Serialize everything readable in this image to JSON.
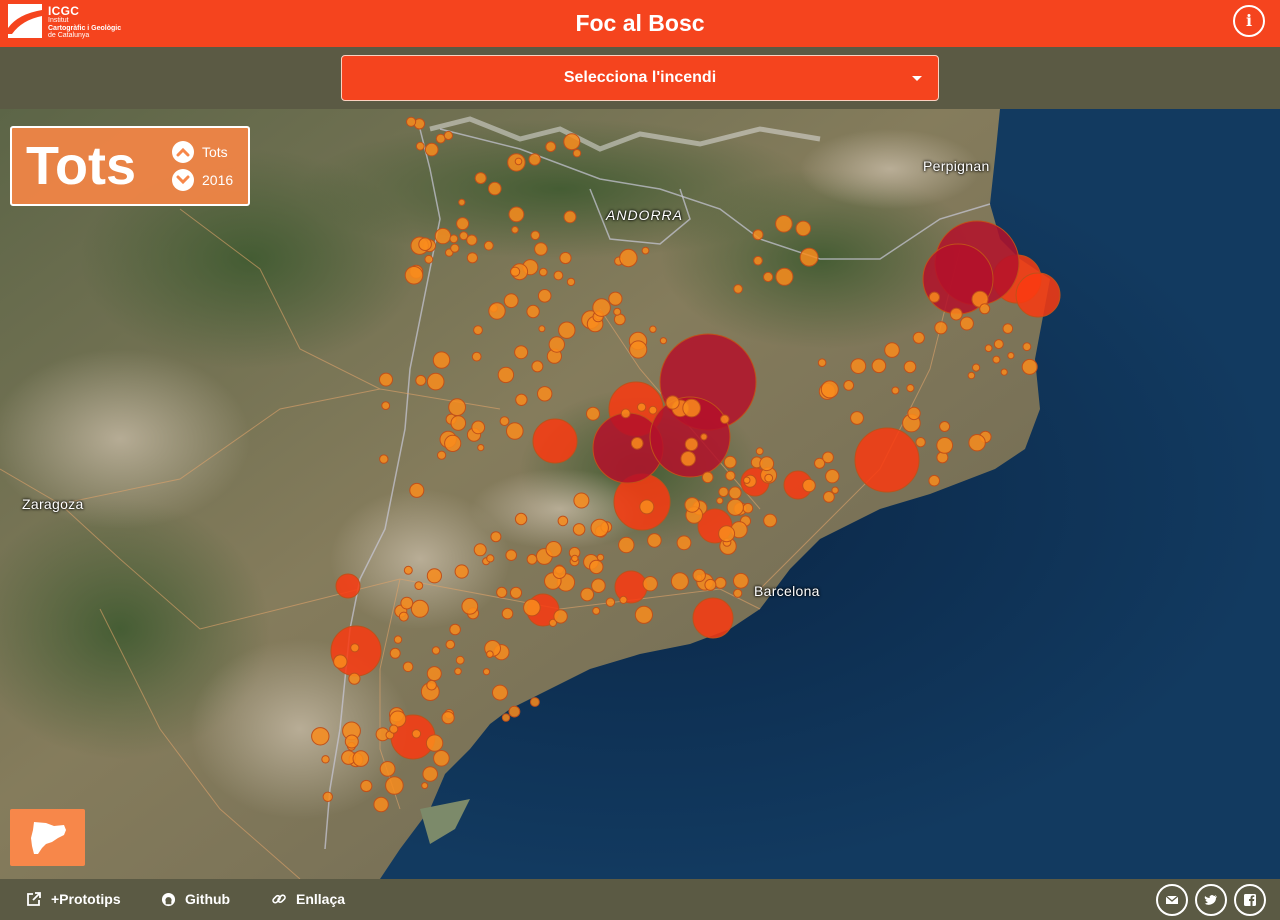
{
  "header": {
    "logo": {
      "abbr": "ICGC",
      "line1": "Institut",
      "line2": "Cartogràfic i Geològic",
      "line3": "de Catalunya"
    },
    "title": "Foc al Bosc",
    "info_icon": "info-icon",
    "info_glyph": "i"
  },
  "selector": {
    "label": "Selecciona l'incendi",
    "caret_icon": "caret-down-icon"
  },
  "filter": {
    "current": "Tots",
    "up_icon": "chevron-up-icon",
    "up_label": "Tots",
    "down_icon": "chevron-down-icon",
    "down_label": "2016"
  },
  "map": {
    "labels": {
      "andorra": "ANDORRA",
      "perpignan": "Perpignan",
      "zaragoza": "Zaragoza",
      "barcelona": "Barcelona"
    },
    "colors": {
      "small_fire": "#f98c1c",
      "medium_fire": "#fa3a10",
      "large_fire": "#b4102a",
      "sea": "#0e2d4e"
    }
  },
  "catalonia_button": {
    "icon": "catalonia-map-icon"
  },
  "footer": {
    "links": [
      {
        "icon": "external-link-icon",
        "label": "+Prototips"
      },
      {
        "icon": "github-icon",
        "label": "Github"
      },
      {
        "icon": "link-icon",
        "label": "Enllaça"
      }
    ],
    "share": [
      {
        "icon": "envelope-icon"
      },
      {
        "icon": "twitter-icon"
      },
      {
        "icon": "facebook-icon"
      }
    ]
  },
  "colors": {
    "accent": "#f5441e",
    "bar": "#5b5a44",
    "panel": "#f7874a"
  }
}
